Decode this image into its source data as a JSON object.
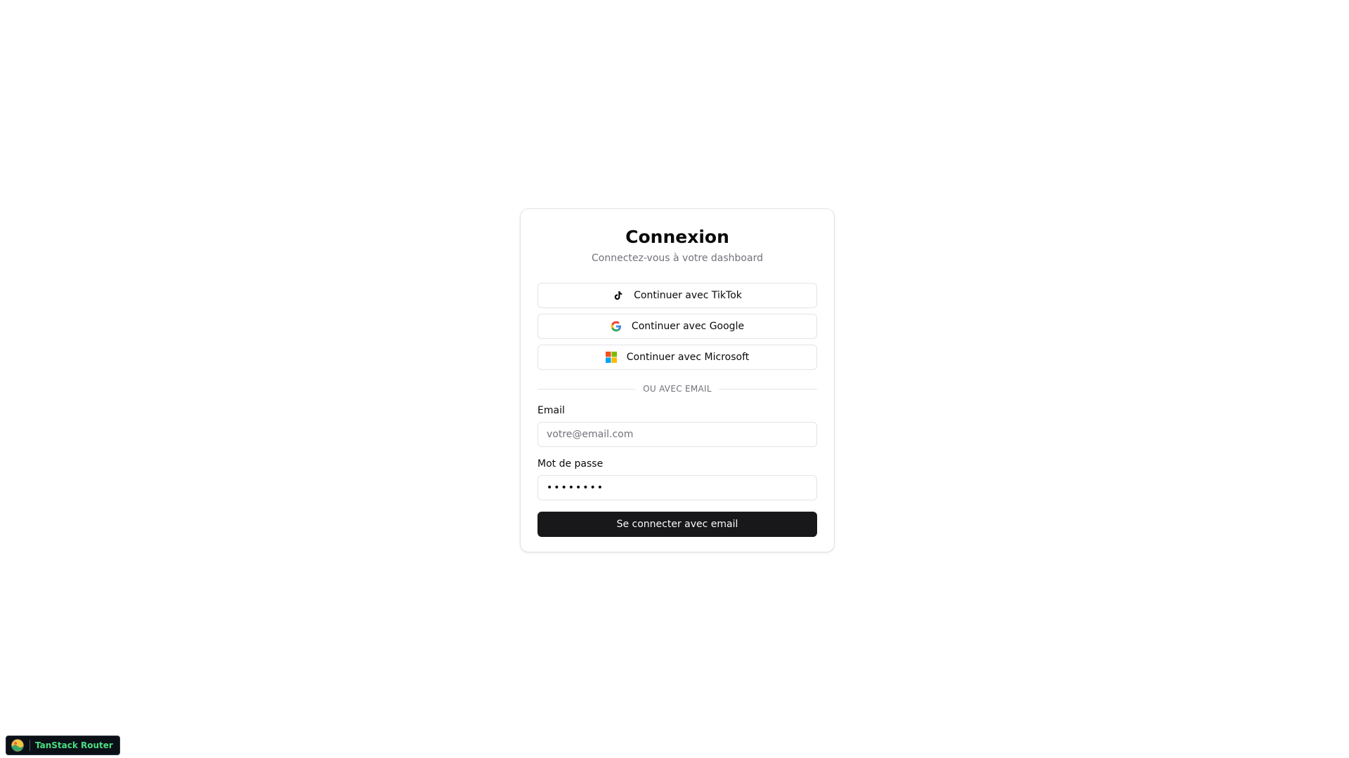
{
  "login": {
    "title": "Connexion",
    "subtitle": "Connectez-vous à votre dashboard",
    "oauth": {
      "tiktok": {
        "label": "Continuer avec TikTok",
        "icon": "tiktok-icon"
      },
      "google": {
        "label": "Continuer avec Google",
        "icon": "google-icon"
      },
      "microsoft": {
        "label": "Continuer avec Microsoft",
        "icon": "microsoft-icon"
      }
    },
    "divider": "OU AVEC EMAIL",
    "email": {
      "label": "Email",
      "value": "",
      "placeholder": "votre@email.com"
    },
    "password": {
      "label": "Mot de passe",
      "value": "••••••••",
      "placeholder": "••••••••"
    },
    "submit_label": "Se connecter avec email"
  },
  "devtools": {
    "label": "TanStack Router",
    "icon": "tanstack-logo-icon"
  },
  "colors": {
    "primary_button": "#18181b",
    "border": "#e4e4e7",
    "muted_text": "#71717a",
    "devtools_accent": "#4ade80",
    "devtools_bg": "#0b1017"
  }
}
